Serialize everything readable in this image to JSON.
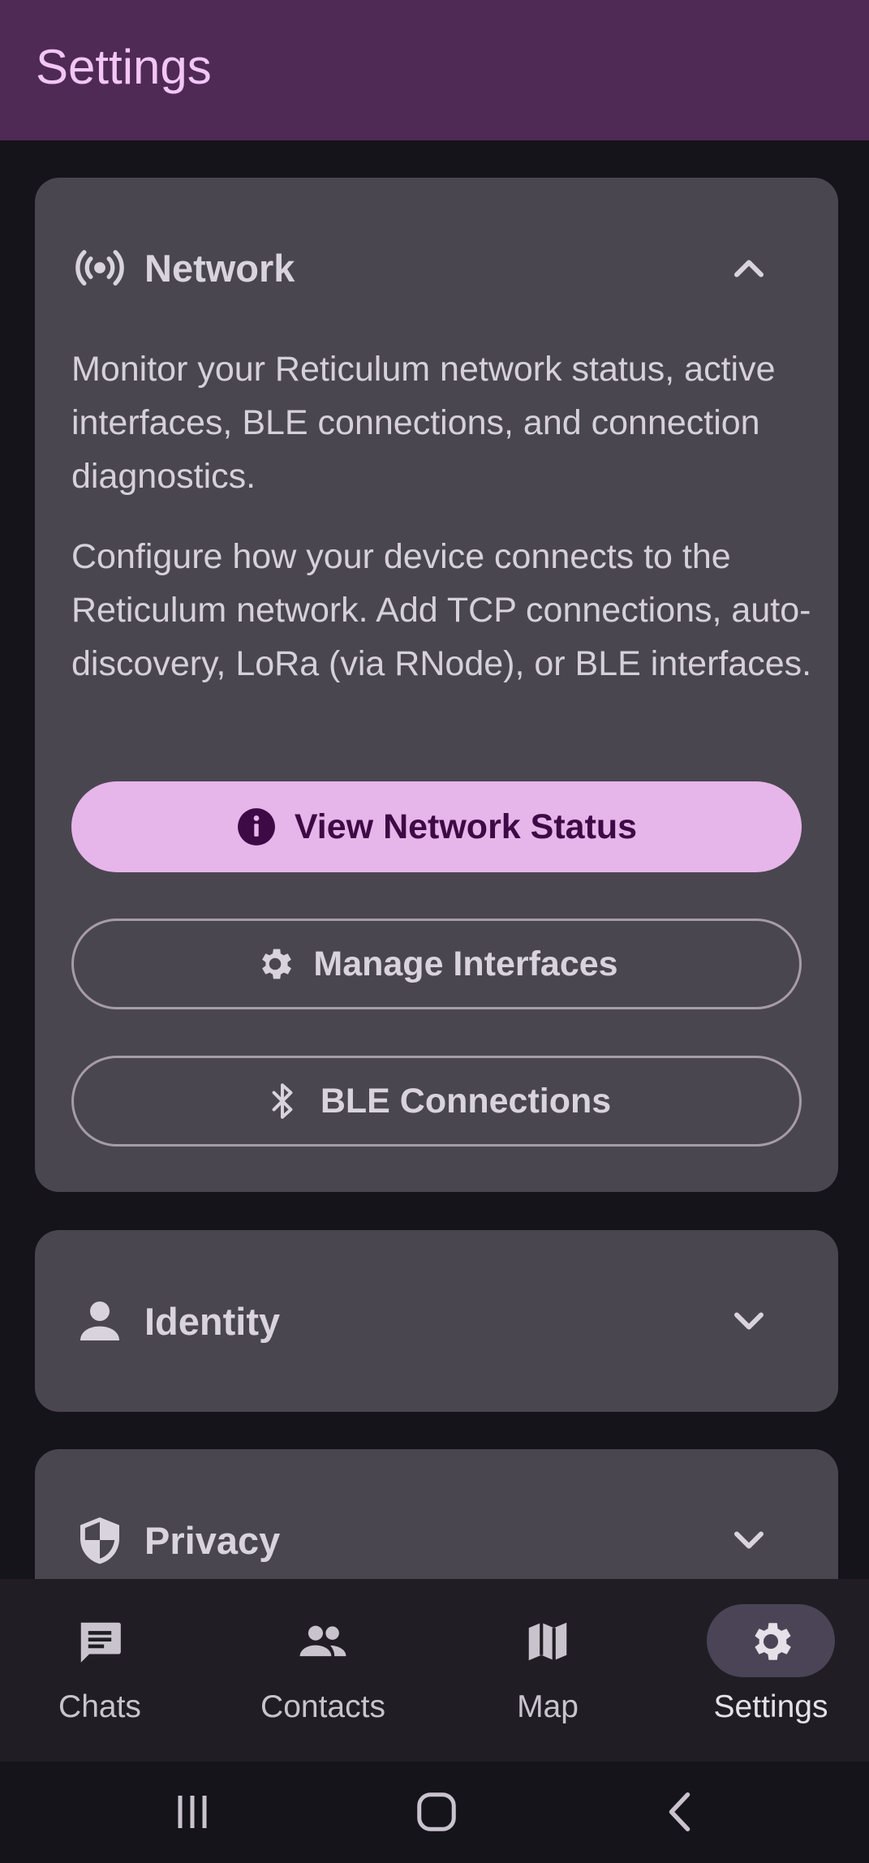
{
  "header": {
    "title": "Settings"
  },
  "network": {
    "label": "Network",
    "icon": "radio-waves-icon",
    "description_1": "Monitor your Reticulum network status, active interfaces, BLE connections, and connection diagnostics.",
    "description_2": "Configure how your device connects to the Reticulum network. Add TCP connections, auto-discovery, LoRa (via RNode), or BLE interfaces.",
    "buttons": {
      "view_status": "View Network Status",
      "manage_interfaces": "Manage Interfaces",
      "ble_connections": "BLE Connections"
    }
  },
  "identity": {
    "label": "Identity",
    "icon": "person-icon"
  },
  "privacy": {
    "label": "Privacy",
    "icon": "shield-icon"
  },
  "nav": {
    "items": [
      {
        "label": "Chats",
        "icon": "chat-icon"
      },
      {
        "label": "Contacts",
        "icon": "people-icon"
      },
      {
        "label": "Map",
        "icon": "map-icon"
      },
      {
        "label": "Settings",
        "icon": "gear-icon",
        "active": true
      }
    ]
  },
  "colors": {
    "accent": "#e6b5ea",
    "topbar": "#4f2a55",
    "card": "#4a4650",
    "background": "#16141b"
  }
}
